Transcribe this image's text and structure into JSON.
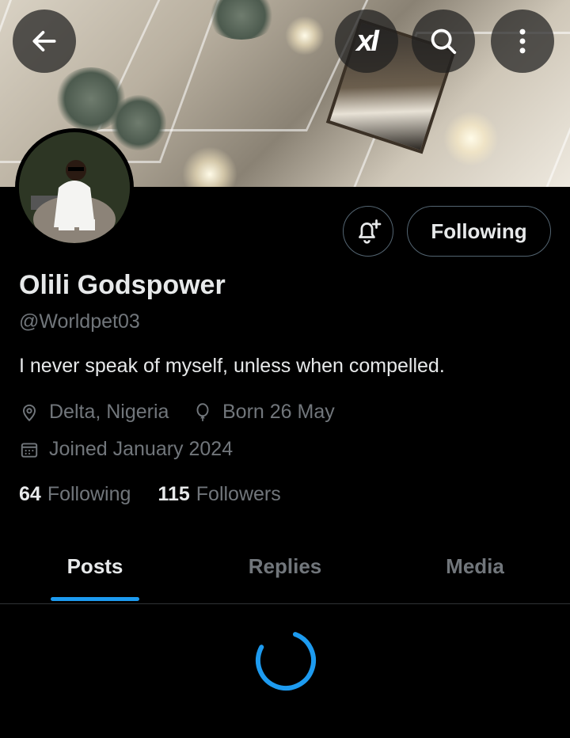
{
  "profile": {
    "name": "Olili Godspower",
    "handle": "@Worldpet03",
    "bio": "I never speak of myself, unless when compelled.",
    "location": "Delta, Nigeria",
    "birthday": "Born 26 May",
    "joined": "Joined January 2024",
    "following_count": "64",
    "following_label": "Following",
    "followers_count": "115",
    "followers_label": "Followers"
  },
  "actions": {
    "follow_state_label": "Following"
  },
  "header": {
    "grok_label": "xI"
  },
  "tabs": [
    {
      "label": "Posts",
      "active": true
    },
    {
      "label": "Replies",
      "active": false
    },
    {
      "label": "Media",
      "active": false
    }
  ],
  "colors": {
    "background": "#000000",
    "primary_text": "#e7e9ea",
    "secondary_text": "#71767b",
    "accent": "#1d9bf0",
    "border": "#536471"
  },
  "icons": [
    "back-arrow-icon",
    "grok-icon",
    "search-icon",
    "more-icon",
    "bell-plus-icon",
    "location-pin-icon",
    "balloon-icon",
    "calendar-icon",
    "loading-spinner-icon"
  ]
}
